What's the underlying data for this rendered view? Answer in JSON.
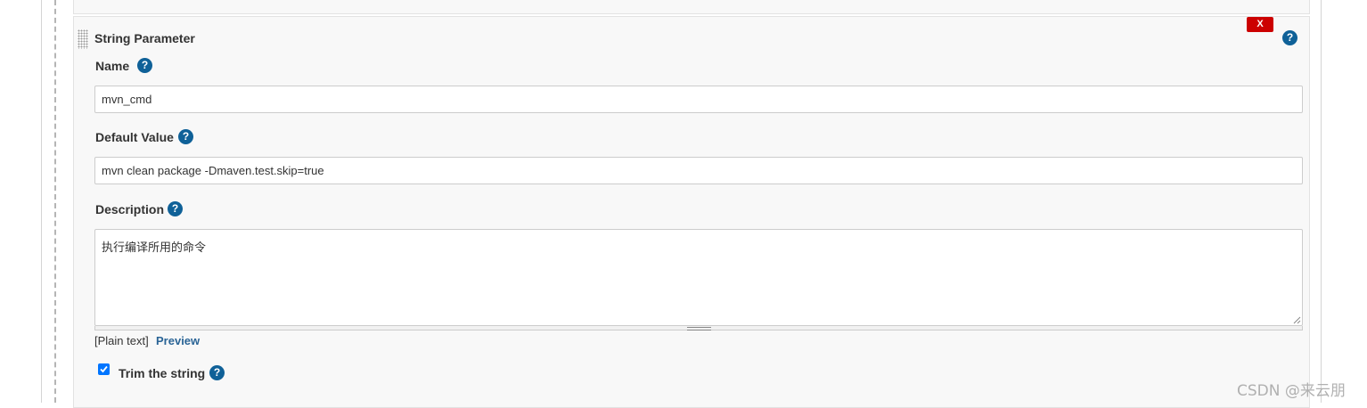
{
  "section": {
    "title": "String Parameter",
    "delete_label": "X"
  },
  "help_symbol": "?",
  "fields": {
    "name": {
      "label": "Name",
      "value": "mvn_cmd"
    },
    "default_value": {
      "label": "Default Value",
      "value": "mvn clean package -Dmaven.test.skip=true"
    },
    "description": {
      "label": "Description",
      "value": "执行编译所用的命令"
    }
  },
  "format": {
    "plain_text": "[Plain text]",
    "preview": "Preview"
  },
  "trim": {
    "label": "Trim the string",
    "checked": true
  },
  "watermark": "CSDN @来云朋",
  "colors": {
    "accent": "#0f6198",
    "delete": "#cc0000",
    "checkbox": "#0075ff",
    "link": "#2a6496"
  }
}
